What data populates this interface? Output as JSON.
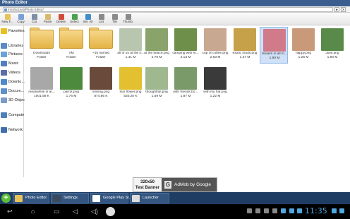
{
  "window": {
    "title": "Photo Editor"
  },
  "address": {
    "path": "/mnt/sdcard/Photo Editor/",
    "go_label": "▸",
    "close_label": "x"
  },
  "toolbar": {
    "buttons": [
      {
        "label": "New F...",
        "icon": "new-folder-icon",
        "color": "#e8c25a"
      },
      {
        "label": "Copy",
        "icon": "copy-icon",
        "color": "#7aa0d6"
      },
      {
        "label": "Cut",
        "icon": "cut-icon",
        "color": "#7f8fa6"
      },
      {
        "label": "Paste",
        "icon": "paste-icon",
        "color": "#d9b86a"
      },
      {
        "label": "Delete",
        "icon": "delete-icon",
        "color": "#d24a3a"
      },
      {
        "label": "Select",
        "icon": "select-icon",
        "color": "#4aa34a"
      },
      {
        "label": "Sel. All",
        "icon": "select-all-icon",
        "color": "#3e8fc9"
      },
      {
        "label": "List",
        "icon": "list-icon",
        "color": "#8a8a8a"
      },
      {
        "label": "Tile",
        "icon": "tile-icon",
        "color": "#8a8a8a"
      },
      {
        "label": "Thumb.",
        "icon": "thumb-icon",
        "color": "#8a8a8a"
      }
    ]
  },
  "sidebar": {
    "items": [
      {
        "label": "Favorites",
        "icon": "star-icon",
        "color": "#e8c020"
      },
      {
        "label": "Libraries",
        "icon": "library-icon",
        "color": "#5a8ac8"
      },
      {
        "label": "Pictures",
        "icon": "pictures-icon",
        "color": "#6aa2d8"
      },
      {
        "label": "Music",
        "icon": "music-icon",
        "color": "#4f7fc0"
      },
      {
        "label": "Videos",
        "icon": "videos-icon",
        "color": "#5b6fa8"
      },
      {
        "label": "Downlo...",
        "icon": "download-icon",
        "color": "#4f88c8"
      },
      {
        "label": "Docum...",
        "icon": "documents-icon",
        "color": "#5f8fc8"
      },
      {
        "label": "3D Objec...",
        "icon": "cube-icon",
        "color": "#7a9ac8"
      },
      {
        "label": "Compute...",
        "icon": "computer-icon",
        "color": "#4f7fb8"
      },
      {
        "label": "Network",
        "icon": "network-icon",
        "color": "#3f6fa8"
      }
    ]
  },
  "files": [
    {
      "name": "Downloads",
      "sub": "Folder",
      "type": "folder"
    },
    {
      "name": "VM",
      "sub": "Folder",
      "type": "folder"
    },
    {
      "name": "~15 named",
      "sub": "Folder",
      "type": "folder"
    },
    {
      "name": "all of us at the li...",
      "sub": "1.41 M",
      "type": "image",
      "color": "#b8c6b0"
    },
    {
      "name": "at the beach.png",
      "sub": "2.70 M",
      "type": "image",
      "color": "#8aa36a"
    },
    {
      "name": "camping with m...",
      "sub": "2.13 M",
      "type": "image",
      "color": "#6d8f4a"
    },
    {
      "name": "cup of coffee.png",
      "sub": "2.83 M",
      "type": "image",
      "color": "#c9a891"
    },
    {
      "name": "exotic foods.png",
      "sub": "1.37 M",
      "type": "image",
      "color": "#c7a04a"
    },
    {
      "name": "flowers in all m...",
      "sub": "1.90 M",
      "type": "image",
      "color": "#d07a8a",
      "selected": true
    },
    {
      "name": "happy.png",
      "sub": "1.25 M",
      "type": "image",
      "color": "#c89a7a"
    },
    {
      "name": "Julie.png",
      "sub": "1.60 M",
      "type": "image",
      "color": "#5a8a4a"
    },
    {
      "name": "meanwhile in ar...",
      "sub": "1001.59 K",
      "type": "image",
      "color": "#a8a8a8"
    },
    {
      "name": "parrot.png",
      "sub": "1.76 M",
      "type": "image",
      "color": "#4e8a3e"
    },
    {
      "name": "smiling.png",
      "sub": "874.86 K",
      "type": "image",
      "color": "#6a4a3a"
    },
    {
      "name": "sun flower.png",
      "sub": "530.20 K",
      "type": "image",
      "color": "#e2c030"
    },
    {
      "name": "thoughtfull.png",
      "sub": "1.59 M",
      "type": "image",
      "color": "#a0b890"
    },
    {
      "name": "with friends bo...",
      "sub": "1.87 M",
      "type": "image",
      "color": "#7a9a6a"
    },
    {
      "name": "with my hat.png",
      "sub": "1.22 M",
      "type": "image",
      "color": "#3a3a3a"
    }
  ],
  "ad": {
    "size": "320x50",
    "label": "Test Banner",
    "brand_text": "AdMob by Google",
    "logo": "G"
  },
  "taskbar": {
    "add_label": "+",
    "tasks": [
      {
        "label": "Photo Editor",
        "icon": "folder-icon",
        "color": "#e8c25a"
      },
      {
        "label": "Settings",
        "icon": "settings-icon",
        "color": "#3a4a5a"
      },
      {
        "label": "Google Play St...",
        "icon": "play-store-icon",
        "color": "#ffffff"
      },
      {
        "label": "Launcher",
        "icon": "home-icon",
        "color": "#dddddd"
      }
    ]
  },
  "navbar": {
    "back": "↩",
    "home": "⌂",
    "recents": "▭",
    "vol_down": "◁",
    "vol_up": "◁)",
    "time": "11:35"
  }
}
